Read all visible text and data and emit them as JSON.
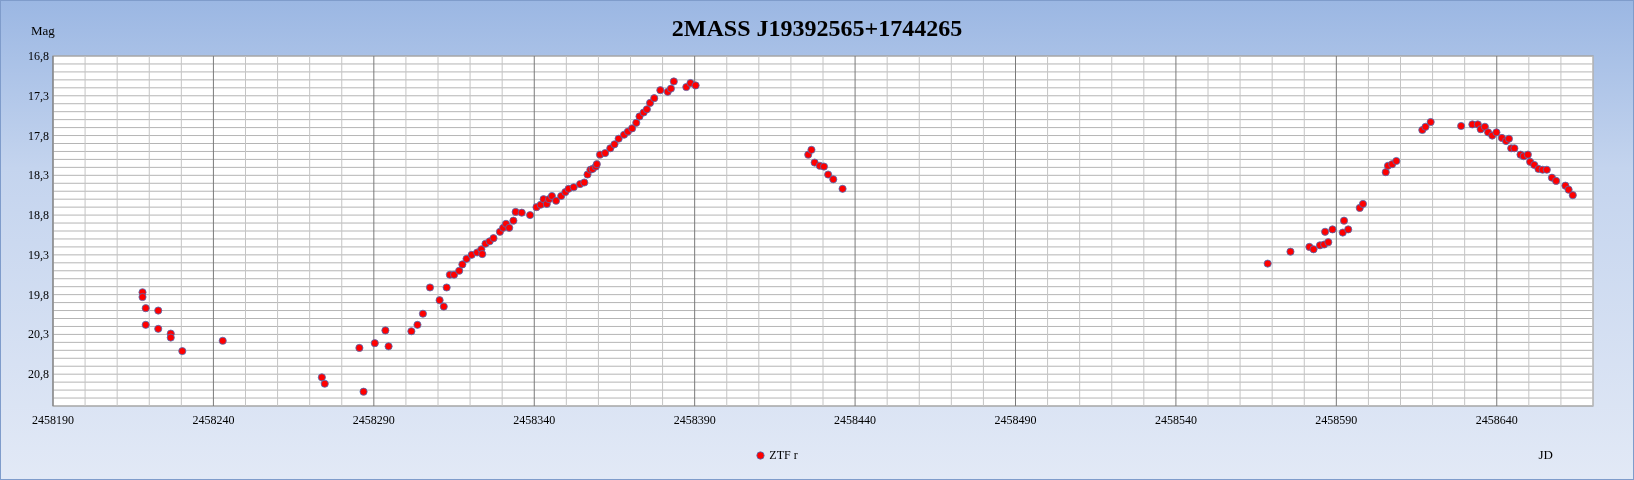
{
  "chart": {
    "chart_data": {
      "type": "scatter",
      "title": "2MASS J19392565+1744265",
      "xlabel": "JD",
      "ylabel": "Mag",
      "xlim": [
        2458190,
        2458670
      ],
      "ylim": [
        21.2,
        16.8
      ],
      "grid": true,
      "xticks": [
        2458190,
        2458240,
        2458290,
        2458340,
        2458390,
        2458440,
        2458490,
        2458540,
        2458590,
        2458640
      ],
      "yticks": [
        {
          "value": 16.8,
          "label": "16,8"
        },
        {
          "value": 17.3,
          "label": "17,3"
        },
        {
          "value": 17.8,
          "label": "17,8"
        },
        {
          "value": 18.3,
          "label": "18,3"
        },
        {
          "value": 18.8,
          "label": "18,8"
        },
        {
          "value": 19.3,
          "label": "19,3"
        },
        {
          "value": 19.8,
          "label": "19,8"
        },
        {
          "value": 20.3,
          "label": "20,3"
        },
        {
          "value": 20.8,
          "label": "20,8"
        }
      ],
      "series": [
        {
          "name": "ZTF r",
          "color": "#ff0000",
          "x": [
            2458217.9,
            2458217.9,
            2458218.9,
            2458218.9,
            2458222.8,
            2458222.8,
            2458226.7,
            2458226.7,
            2458230.3,
            2458242.9,
            2458273.8,
            2458274.7,
            2458286.8,
            2458285.5,
            2458290.3,
            2458293.6,
            2458294.6,
            2458301.7,
            2458303.6,
            2458305.3,
            2458307.5,
            2458310.5,
            2458311.8,
            2458312.7,
            2458313.7,
            2458315.0,
            2458316.6,
            2458317.6,
            2458318.9,
            2458320.5,
            2458322.2,
            2458323.5,
            2458323.8,
            2458324.8,
            2458326.1,
            2458327.3,
            2458329.3,
            2458330.3,
            2458331.2,
            2458332.2,
            2458333.5,
            2458334.2,
            2458336.1,
            2458338.7,
            2458340.7,
            2458342.0,
            2458342.9,
            2458343.9,
            2458344.6,
            2458345.5,
            2458346.8,
            2458348.4,
            2458349.7,
            2458350.7,
            2458352.3,
            2458354.3,
            2458355.6,
            2458356.6,
            2458357.5,
            2458358.2,
            2458359.2,
            2458359.5,
            2458360.5,
            2458362.1,
            2458363.7,
            2458365.0,
            2458366.3,
            2458368.0,
            2458369.2,
            2458370.5,
            2458371.8,
            2458372.8,
            2458374.1,
            2458375.1,
            2458376.1,
            2458377.4,
            2458379.3,
            2458381.6,
            2458382.6,
            2458383.5,
            2458387.4,
            2458388.7,
            2458390.3,
            2458425.4,
            2458426.4,
            2458427.4,
            2458429.0,
            2458430.3,
            2458431.6,
            2458433.2,
            2458436.1,
            2458568.6,
            2458575.7,
            2458581.6,
            2458582.9,
            2458584.9,
            2458586.2,
            2458587.5,
            2458586.5,
            2458588.8,
            2458592.0,
            2458592.4,
            2458593.7,
            2458597.3,
            2458598.3,
            2458605.4,
            2458606.1,
            2458607.4,
            2458608.7,
            2458616.8,
            2458617.8,
            2458619.4,
            2458628.9,
            2458632.4,
            2458634.1,
            2458635.0,
            2458636.3,
            2458637.3,
            2458638.6,
            2458639.9,
            2458641.6,
            2458642.9,
            2458643.8,
            2458644.5,
            2458645.5,
            2458647.4,
            2458648.4,
            2458649.7,
            2458650.4,
            2458651.7,
            2458653.0,
            2458654.3,
            2458655.6,
            2458657.2,
            2458658.5,
            2458661.4,
            2458662.4,
            2458663.7
          ],
          "values": [
            19.77,
            19.83,
            19.97,
            20.18,
            20.0,
            20.23,
            20.29,
            20.34,
            20.51,
            20.38,
            20.84,
            20.92,
            21.02,
            20.47,
            20.41,
            20.25,
            20.45,
            20.26,
            20.18,
            20.04,
            19.71,
            19.87,
            19.95,
            19.71,
            19.55,
            19.55,
            19.5,
            19.42,
            19.35,
            19.3,
            19.27,
            19.23,
            19.29,
            19.16,
            19.13,
            19.09,
            19.01,
            18.96,
            18.91,
            18.96,
            18.87,
            18.76,
            18.77,
            18.8,
            18.7,
            18.67,
            18.6,
            18.66,
            18.6,
            18.56,
            18.62,
            18.56,
            18.51,
            18.47,
            18.45,
            18.41,
            18.39,
            18.29,
            18.23,
            18.22,
            18.19,
            18.16,
            18.04,
            18.02,
            17.96,
            17.91,
            17.84,
            17.79,
            17.75,
            17.71,
            17.64,
            17.56,
            17.51,
            17.47,
            17.39,
            17.33,
            17.23,
            17.25,
            17.21,
            17.12,
            17.19,
            17.14,
            17.17,
            18.04,
            17.98,
            18.14,
            18.18,
            18.19,
            18.29,
            18.35,
            18.47,
            19.41,
            19.26,
            19.2,
            19.23,
            19.18,
            19.17,
            19.14,
            19.01,
            18.98,
            19.02,
            18.87,
            18.98,
            18.71,
            18.66,
            18.26,
            18.18,
            18.16,
            18.12,
            17.73,
            17.69,
            17.63,
            17.68,
            17.66,
            17.66,
            17.72,
            17.69,
            17.76,
            17.8,
            17.76,
            17.83,
            17.87,
            17.84,
            17.96,
            17.96,
            18.04,
            18.06,
            18.04,
            18.13,
            18.17,
            18.22,
            18.23,
            18.23,
            18.33,
            18.37,
            18.43,
            18.48,
            18.55
          ]
        }
      ]
    }
  }
}
